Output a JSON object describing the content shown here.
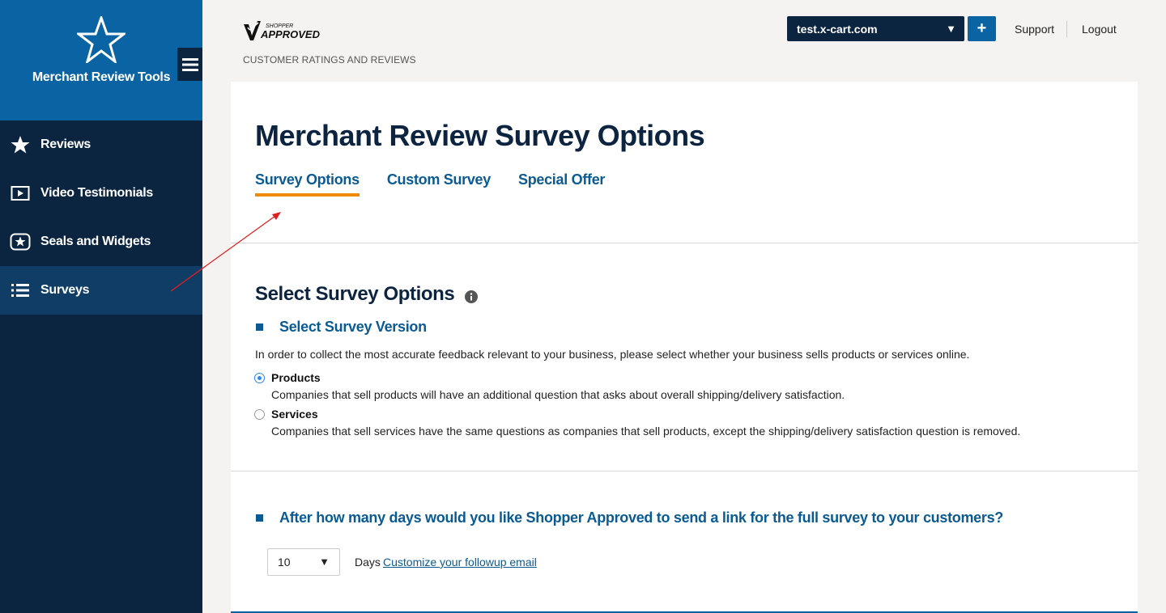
{
  "sidebar": {
    "brand_title": "Merchant Review Tools",
    "items": [
      {
        "label": "Reviews",
        "icon": "star-icon"
      },
      {
        "label": "Video Testimonials",
        "icon": "video-play-icon"
      },
      {
        "label": "Seals and Widgets",
        "icon": "star-badge-icon"
      },
      {
        "label": "Surveys",
        "icon": "list-icon"
      }
    ],
    "active_item": "Surveys"
  },
  "header": {
    "logo_top": "SHOPPER",
    "logo_main": "APPROVED",
    "tagline": "CUSTOMER RATINGS AND REVIEWS",
    "site_select_value": "test.x-cart.com",
    "add_label": "+",
    "support_label": "Support",
    "logout_label": "Logout"
  },
  "main": {
    "title": "Merchant Review Survey Options",
    "tabs": [
      {
        "label": "Survey Options",
        "active": true
      },
      {
        "label": "Custom Survey",
        "active": false
      },
      {
        "label": "Special Offer",
        "active": false
      }
    ],
    "section_title": "Select Survey Options",
    "version": {
      "title": "Select Survey Version",
      "description": "In order to collect the most accurate feedback relevant to your business, please select whether your business sells products or services online.",
      "options": [
        {
          "label": "Products",
          "description": "Companies that sell products will have an additional question that asks about overall shipping/delivery satisfaction.",
          "checked": true
        },
        {
          "label": "Services",
          "description": "Companies that sell services have the same questions as companies that sell products, except the shipping/delivery satisfaction question is removed.",
          "checked": false
        }
      ]
    },
    "followup": {
      "title": "After how many days would you like Shopper Approved to send a link for the full survey to your customers?",
      "days_value": "10",
      "days_label": "Days",
      "customize_link": "Customize your followup email"
    }
  },
  "colors": {
    "sidebar_bg": "#0b2440",
    "brand_bg": "#0a64a4",
    "active_nav_bg": "#103d66",
    "accent_blue": "#0a5b94",
    "tab_underline": "#f08a00",
    "annotation_arrow": "#e02020"
  }
}
